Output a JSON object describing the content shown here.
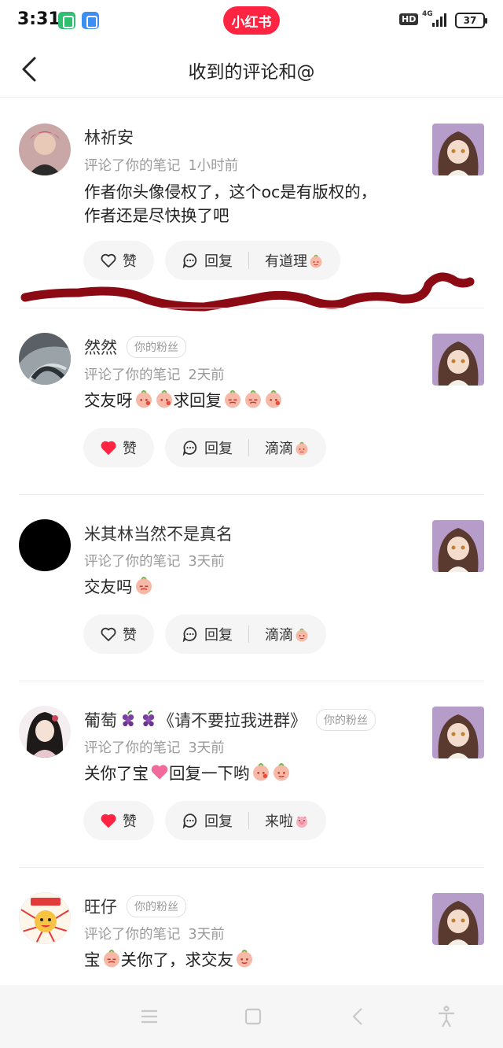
{
  "status_bar": {
    "time": "3:31",
    "app_logo": "小红书",
    "hd": "HD",
    "network": "4G",
    "battery": "37"
  },
  "header": {
    "title": "收到的评论和@"
  },
  "comments": [
    {
      "name": "林祈安",
      "fan_badge": "",
      "action": "评论了你的笔记",
      "time": "1小时前",
      "text_line1": "作者你头像侵权了，这个oc是有版权的，",
      "text_line2": "作者还是尽快换了吧",
      "liked": false,
      "like_label": "赞",
      "reply_label": "回复",
      "quick_reply": "有道理"
    },
    {
      "name": "然然",
      "fan_badge": "你的粉丝",
      "action": "评论了你的笔记",
      "time": "2天前",
      "text_a": "交友呀",
      "text_b": "求回复",
      "liked": true,
      "like_label": "赞",
      "reply_label": "回复",
      "quick_reply": "滴滴"
    },
    {
      "name": "米其林当然不是真名",
      "fan_badge": "",
      "action": "评论了你的笔记",
      "time": "3天前",
      "text_a": "交友吗",
      "liked": false,
      "like_label": "赞",
      "reply_label": "回复",
      "quick_reply": "滴滴"
    },
    {
      "name": "葡萄",
      "name_suffix": "《请不要拉我进群》",
      "fan_badge": "你的粉丝",
      "action": "评论了你的笔记",
      "time": "3天前",
      "text_a": "关你了宝",
      "text_b": "回复一下哟",
      "liked": true,
      "like_label": "赞",
      "reply_label": "回复",
      "quick_reply": "来啦"
    },
    {
      "name": "旺仔",
      "fan_badge": "你的粉丝",
      "action": "评论了你的笔记",
      "time": "3天前",
      "text_a": "宝",
      "text_b": "关你了，求交友"
    }
  ],
  "icons": {
    "back": "chevron-left-icon",
    "like": "heart-icon",
    "reply": "comment-bubble-icon",
    "emoji": "face-emoji-icon"
  },
  "colors": {
    "brand": "#ff2442",
    "like_active": "#ff2442",
    "annotation_stroke": "#8b0a14"
  }
}
